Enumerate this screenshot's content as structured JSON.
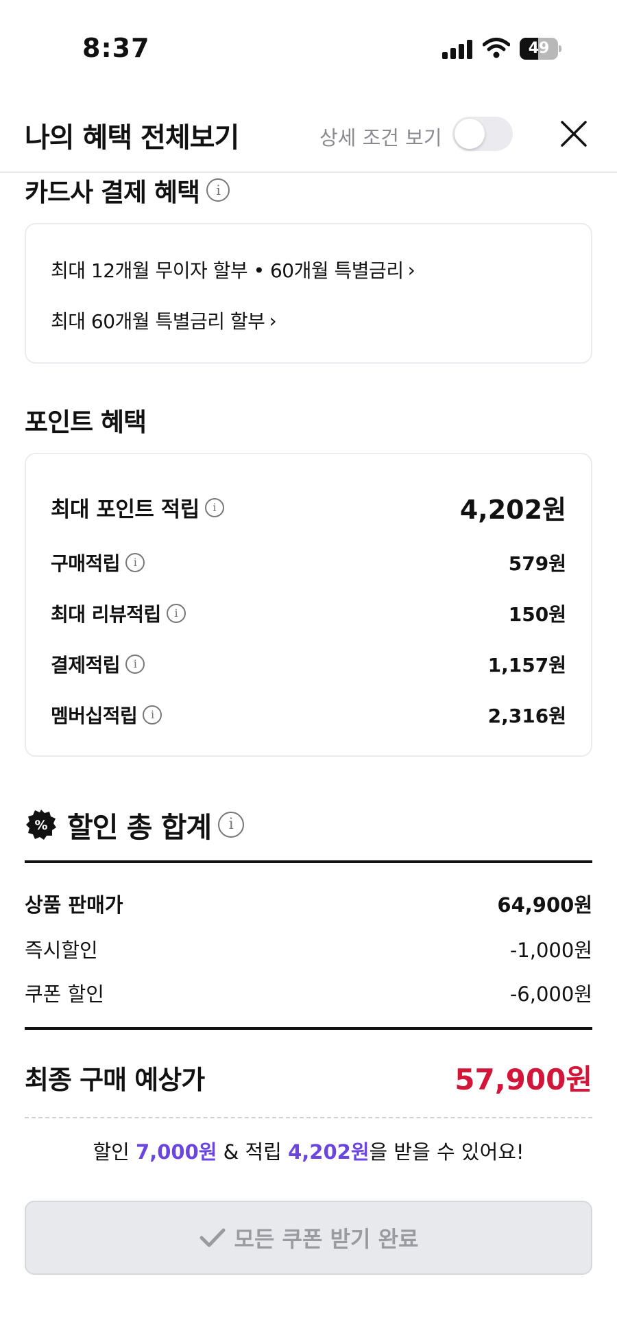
{
  "status_bar": {
    "time": "8:37",
    "battery": "49",
    "battery_level": 0.49
  },
  "header": {
    "title": "나의 혜택 전체보기",
    "detail_toggle_label": "상세 조건 보기",
    "detail_toggle_on": false
  },
  "card_benefits": {
    "title": "카드사 결제 혜택",
    "links": [
      {
        "label": "최대 12개월 무이자 할부 • 60개월 특별금리"
      },
      {
        "label": "최대 60개월 특별금리 할부"
      }
    ]
  },
  "point_benefits": {
    "title": "포인트 혜택",
    "max_label": "최대 포인트 적립",
    "max_value": "4,202원",
    "rows": [
      {
        "label": "구매적립",
        "value": "579원"
      },
      {
        "label": "최대 리뷰적립",
        "value": "150원"
      },
      {
        "label": "결제적립",
        "value": "1,157원"
      },
      {
        "label": "멤버십적립",
        "value": "2,316원"
      }
    ]
  },
  "discount_total": {
    "title": "할인 총 합계",
    "rows": [
      {
        "label": "상품 판매가",
        "value": "64,900원",
        "bold": true
      },
      {
        "label": "즉시할인",
        "value": "-1,000원"
      },
      {
        "label": "쿠폰 할인",
        "value": "-6,000원"
      }
    ],
    "final_label": "최종 구매 예상가",
    "final_value": "57,900원"
  },
  "summary": {
    "prefix": "할인 ",
    "discount": "7,000원",
    "middle": " & 적립 ",
    "points": "4,202원",
    "suffix": "을 받을 수 있어요!"
  },
  "cta": {
    "label": "모든 쿠폰 받기 완료"
  },
  "colors": {
    "accent_purple": "#6b45e0",
    "price_red": "#d4153a"
  }
}
